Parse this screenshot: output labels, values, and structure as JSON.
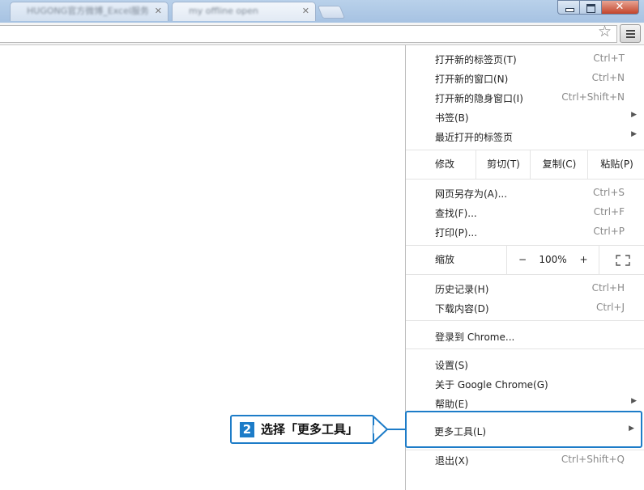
{
  "tabs": [
    {
      "title": "HUGONG官方微博_Excel服务"
    },
    {
      "title": "my offline open"
    }
  ],
  "window_controls": {
    "minimize": "—",
    "maximize": "□",
    "close": "✕"
  },
  "toolbar": {
    "bookmark_icon": "star-icon",
    "menu_icon": "hamburger-menu-icon"
  },
  "menu": {
    "new_tab": {
      "label": "打开新的标签页(T)",
      "shortcut": "Ctrl+T"
    },
    "new_window": {
      "label": "打开新的窗口(N)",
      "shortcut": "Ctrl+N"
    },
    "incognito": {
      "label": "打开新的隐身窗口(I)",
      "shortcut": "Ctrl+Shift+N"
    },
    "bookmarks": {
      "label": "书签(B)"
    },
    "recent_tabs": {
      "label": "最近打开的标签页"
    },
    "edit": {
      "label": "修改",
      "cut": "剪切(T)",
      "copy": "复制(C)",
      "paste": "粘贴(P)"
    },
    "save_as": {
      "label": "网页另存为(A)...",
      "shortcut": "Ctrl+S"
    },
    "find": {
      "label": "查找(F)...",
      "shortcut": "Ctrl+F"
    },
    "print": {
      "label": "打印(P)...",
      "shortcut": "Ctrl+P"
    },
    "zoom": {
      "label": "缩放",
      "minus": "−",
      "value": "100%",
      "plus": "+"
    },
    "history": {
      "label": "历史记录(H)",
      "shortcut": "Ctrl+H"
    },
    "downloads": {
      "label": "下载内容(D)",
      "shortcut": "Ctrl+J"
    },
    "sign_in": {
      "label": "登录到 Chrome..."
    },
    "settings": {
      "label": "设置(S)"
    },
    "about": {
      "label": "关于 Google Chrome(G)"
    },
    "help": {
      "label": "帮助(E)"
    },
    "more_tools": {
      "label": "更多工具(L)"
    },
    "exit": {
      "label": "退出(X)",
      "shortcut": "Ctrl+Shift+Q"
    }
  },
  "callout": {
    "step": "2",
    "text": "选择「更多工具」"
  },
  "colors": {
    "accent": "#1d7cc8"
  }
}
